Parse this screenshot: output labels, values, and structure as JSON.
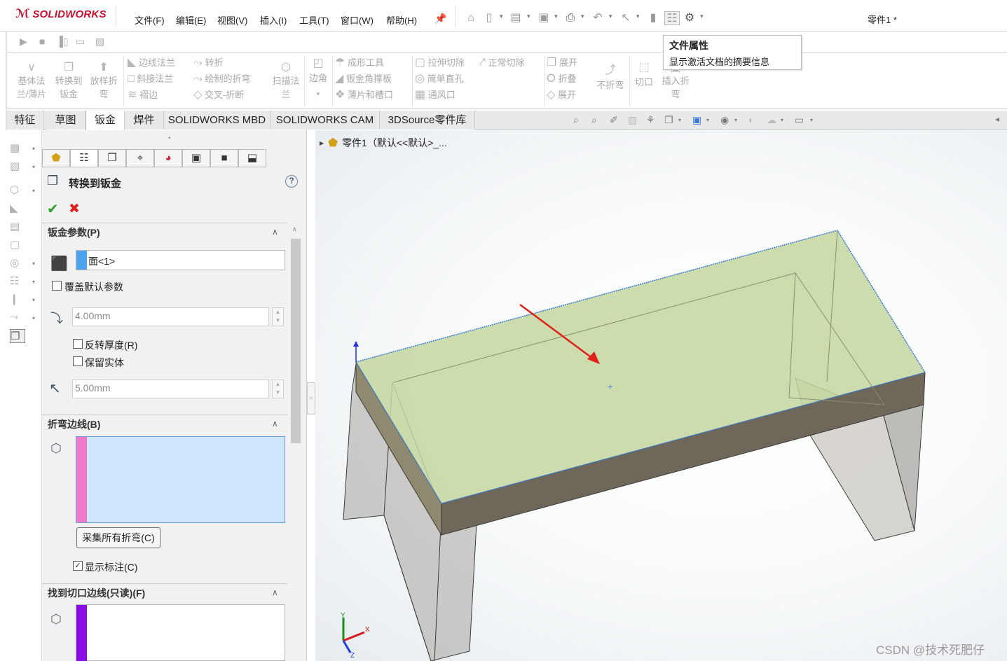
{
  "app": {
    "brand_prefix": "3DS",
    "brand": "SOLIDWORKS",
    "doc_title": "零件1 *"
  },
  "menu": [
    "文件(F)",
    "编辑(E)",
    "视图(V)",
    "插入(I)",
    "工具(T)",
    "窗口(W)",
    "帮助(H)"
  ],
  "tooltip": {
    "title": "文件属性",
    "desc": "显示激活文档的摘要信息"
  },
  "ribbon": {
    "base_flange": [
      "基体法",
      "兰/薄片"
    ],
    "convert": [
      "转换到",
      "钣金"
    ],
    "loft_bend": [
      "放样折",
      "弯"
    ],
    "col1": [
      "边线法兰",
      "斜接法兰",
      "褶边"
    ],
    "col2": [
      "转折",
      "绘制的折弯",
      "交叉-折断"
    ],
    "swept": [
      "扫描法",
      "兰"
    ],
    "corner": "边角",
    "col3": [
      "成形工具",
      "钣金角撑板",
      "薄片和槽口"
    ],
    "col4": [
      "拉伸切除",
      "简单直孔",
      "通风口"
    ],
    "normal_cut": "正常切除",
    "col5": [
      "展开",
      "折叠",
      "展开"
    ],
    "no_bends": "不折弯",
    "rip": "切口",
    "insert_bends": [
      "插入折",
      "弯"
    ]
  },
  "tabs": [
    "特征",
    "草图",
    "钣金",
    "焊件",
    "SOLIDWORKS MBD",
    "SOLIDWORKS CAM",
    "3DSource零件库"
  ],
  "active_tab": "钣金",
  "pm": {
    "title": "转换到钣金",
    "help": "?",
    "ok": "✔",
    "cancel": "✖",
    "sec_params": "钣金参数(P)",
    "face_value": "面<1>",
    "override": "覆盖默认参数",
    "thickness": "4.00mm",
    "reverse": "反转厚度(R)",
    "keep_body": "保留实体",
    "radius": "5.00mm",
    "sec_bend": "折弯边线(B)",
    "collect_btn": "采集所有折弯(C)",
    "show_callouts": "显示标注(C)",
    "sec_rip": "找到切口边线(只读)(F)"
  },
  "tree": {
    "label": "零件1（默认<<默认>_..."
  },
  "triad": {
    "x": "X",
    "y": "Y",
    "z": "Z"
  },
  "watermark": "CSDN @技术死肥仔",
  "colors": {
    "accent_red": "#e0201c",
    "top_face": "#c9d8a4",
    "side_face": "#6f6758",
    "edge_highlight": "#3a7bd5"
  }
}
